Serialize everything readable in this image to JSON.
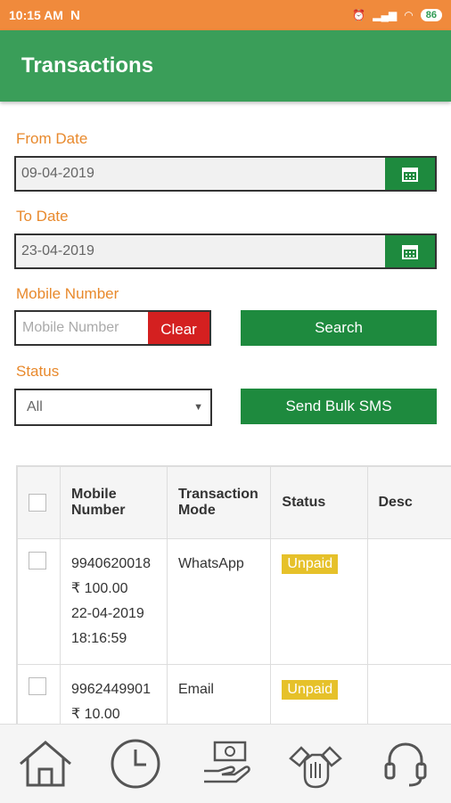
{
  "status_bar": {
    "time": "10:15 AM",
    "notification_icon": "N",
    "battery": "86"
  },
  "header": {
    "title": "Transactions"
  },
  "form": {
    "from_date_label": "From Date",
    "from_date_value": "09-04-2019",
    "to_date_label": "To Date",
    "to_date_value": "23-04-2019",
    "mobile_label": "Mobile Number",
    "mobile_placeholder": "Mobile Number",
    "clear_label": "Clear",
    "search_label": "Search",
    "status_label": "Status",
    "status_selected": "All",
    "send_bulk_sms_label": "Send Bulk SMS"
  },
  "table": {
    "headers": {
      "mobile_line1": "Mobile",
      "mobile_line2": "Number",
      "mode_line1": "Transaction",
      "mode_line2": "Mode",
      "status": "Status",
      "desc": "Desc"
    },
    "rows": [
      {
        "mobile": "9940620018",
        "amount": "₹ 100.00",
        "date": "22-04-2019",
        "time": "18:16:59",
        "mode": "WhatsApp",
        "status": "Unpaid",
        "desc": ""
      },
      {
        "mobile": "9962449901",
        "amount": "₹ 10.00",
        "date": "",
        "time": "",
        "mode": "Email",
        "status": "Unpaid",
        "desc": ""
      }
    ]
  },
  "bottom_nav": {
    "icons": [
      "home-icon",
      "clock-icon",
      "payment-icon",
      "handshake-icon",
      "support-headset-icon"
    ]
  },
  "colors": {
    "status_bar": "#f08a3c",
    "app_bar": "#3a9e59",
    "button_green": "#1e8a3e",
    "clear_red": "#d42020",
    "label_orange": "#e8892c",
    "badge_yellow": "#e6c12a"
  }
}
